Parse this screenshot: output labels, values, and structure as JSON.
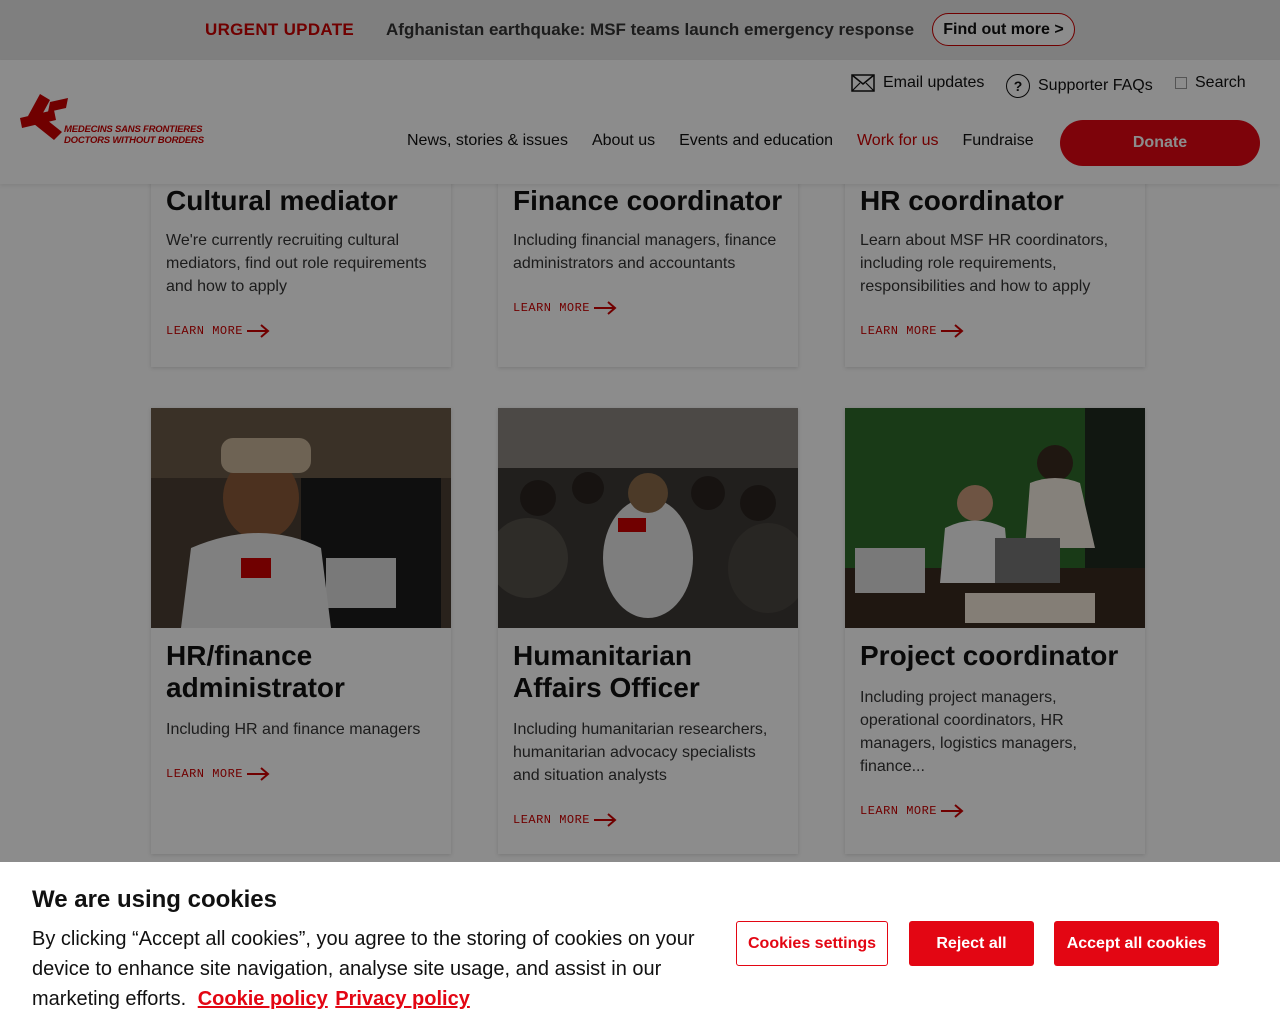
{
  "urgent": {
    "label": "URGENT UPDATE",
    "text": "Afghanistan earthquake: MSF teams launch emergency response",
    "button": "Find out more >"
  },
  "header": {
    "logo_line1": "MEDECINS SANS FRONTIERES",
    "logo_line2": "DOCTORS WITHOUT BORDERS",
    "email_updates": "Email updates",
    "faqs": "Supporter FAQs",
    "search": "Search",
    "nav": [
      "News, stories & issues",
      "About us",
      "Events and education",
      "Work for us",
      "Fundraise"
    ],
    "donate": "Donate"
  },
  "cards_top": [
    {
      "title": "Cultural mediator",
      "desc": "We're currently recruiting cultural mediators, find out role requirements and how to apply",
      "cta": "LEARN MORE"
    },
    {
      "title": "Finance coordinator",
      "desc": "Including financial managers, finance administrators and accountants",
      "cta": "LEARN MORE"
    },
    {
      "title": "HR coordinator",
      "desc": "Learn about MSF HR coordinators, including role requirements, responsibilities and how to apply",
      "cta": "LEARN MORE"
    }
  ],
  "cards_bottom": [
    {
      "title": "HR/finance administrator",
      "desc": "Including HR and finance managers",
      "cta": "LEARN MORE"
    },
    {
      "title": "Humanitarian Affairs Officer",
      "desc": "Including humanitarian researchers, humanitarian advocacy specialists and situation analysts",
      "cta": "LEARN MORE"
    },
    {
      "title": "Project coordinator",
      "desc": "Including project managers, operational coordinators, HR managers, logistics managers, finance...",
      "cta": "LEARN MORE"
    }
  ],
  "cookie": {
    "title": "We are using cookies",
    "text": "By clicking “Accept all cookies”, you agree to the storing of cookies on your device to enhance site navigation, analyse site usage, and assist in our marketing efforts.",
    "cookie_policy": "Cookie policy",
    "privacy_policy": "Privacy policy",
    "settings": "Cookies settings",
    "reject": "Reject all",
    "accept": "Accept all cookies"
  }
}
